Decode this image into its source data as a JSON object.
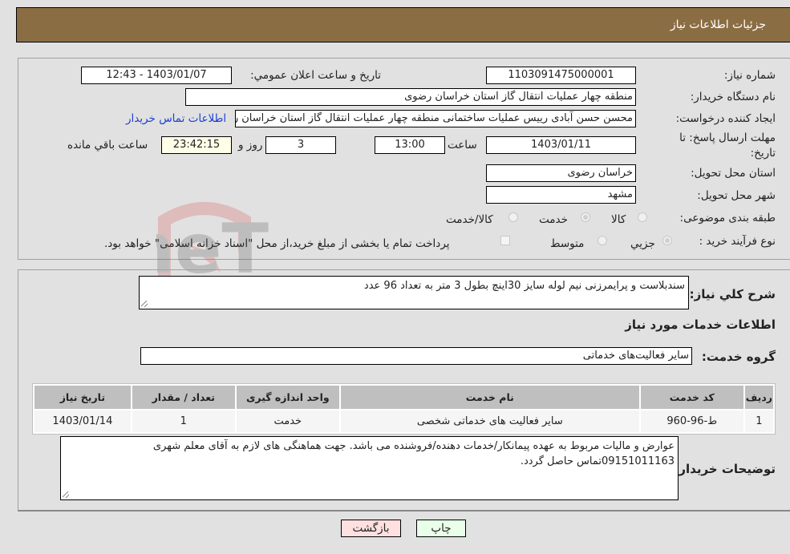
{
  "header": {
    "title": "جزئيات اطلاعات نياز"
  },
  "need_info": {
    "need_number_label": "شماره نیاز:",
    "need_number": "1103091475000001",
    "announce_label": "تاریخ و ساعت اعلان عمومي:",
    "announce_value": "1403/01/07 - 12:43",
    "buyer_org_label": "نام دستگاه خریدار:",
    "buyer_org": "منطقه چهار عملیات انتقال گاز   استان خراسان رضوی",
    "creator_label": "ایجاد کننده درخواست:",
    "creator": "محسن حسن آبادی رییس عملیات ساختمانی منطقه چهار عملیات انتقال گاز   استان خراسان رضوی",
    "contact_link": "اطلاعات تماس خریدار",
    "deadline_label": "مهلت ارسال پاسخ: تا تاریخ:",
    "deadline_date": "1403/01/11",
    "time_label": "ساعت",
    "deadline_time": "13:00",
    "days_value": "3",
    "days_label": "روز و",
    "remaining_time": "23:42:15",
    "remaining_label": "ساعت باقي مانده",
    "province_label": "استان محل تحویل:",
    "province": "خراسان رضوی",
    "city_label": "شهر محل تحویل:",
    "city": "مشهد",
    "category_label": "طبقه بندی موضوعی:",
    "category_options": [
      {
        "label": "کالا",
        "checked": false
      },
      {
        "label": "خدمت",
        "checked": true
      },
      {
        "label": "کالا/خدمت",
        "checked": false
      }
    ],
    "process_label": "نوع فرآیند خرید :",
    "process_options": [
      {
        "label": "جزيي",
        "checked": true
      },
      {
        "label": "متوسط",
        "checked": false
      }
    ],
    "treasury_note": "پرداخت تمام یا بخشی از مبلغ خرید،از محل \"اسناد خزانه اسلامی\" خواهد بود."
  },
  "details": {
    "summary_label": "شرح كلي نياز:",
    "summary": "سندبلاست و پرایمرزنی نیم لوله سایز 30اینچ بطول 3 متر به تعداد 96 عدد",
    "services_heading": "اطلاعات خدمات مورد نياز",
    "service_group_label": "گروه خدمت:",
    "service_group": "سایر فعالیت‌های خدماتی",
    "table": {
      "headers": [
        "رديف",
        "كد خدمت",
        "نام خدمت",
        "واحد اندازه گيری",
        "تعداد / مقدار",
        "تاريخ نياز"
      ],
      "rows": [
        [
          "1",
          "ط-96-960",
          "سایر فعالیت های خدماتی شخصی",
          "خدمت",
          "1",
          "1403/01/14"
        ]
      ]
    },
    "buyer_notes_label": "توضيحات خريدار:",
    "buyer_notes": "عوارض و مالیات مربوط به عهده پیمانکار/خدمات دهنده/فروشنده می باشد. جهت هماهنگی های لازم به آقای معلم شهری 09151011163تماس حاصل گردد."
  },
  "buttons": {
    "print": "چاپ",
    "back": "بازگشت"
  },
  "watermark": {
    "text": "AriaTender.neT"
  },
  "colors": {
    "header_bg": "#8b6d44",
    "link": "#1a3fd6",
    "print_bg": "#eaffea",
    "back_bg": "#ffe0e0"
  }
}
